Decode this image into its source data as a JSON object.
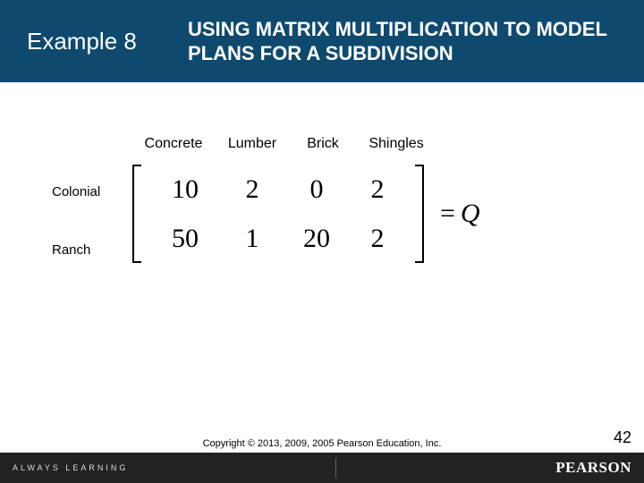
{
  "header": {
    "example_label": "Example 8",
    "title": "USING MATRIX MULTIPLICATION TO MODEL PLANS FOR A SUBDIVISION"
  },
  "columns": {
    "concrete": "Concrete",
    "lumber": "Lumber",
    "brick": "Brick",
    "shingles": "Shingles"
  },
  "rows": {
    "colonial": "Colonial",
    "ranch": "Ranch"
  },
  "matrix": {
    "r1c1": "10",
    "r1c2": "2",
    "r1c3": "0",
    "r1c4": "2",
    "r2c1": "50",
    "r2c2": "1",
    "r2c3": "20",
    "r2c4": "2"
  },
  "equation": {
    "equals": "=",
    "name": "Q"
  },
  "footer": {
    "tagline": "ALWAYS LEARNING",
    "copyright": "Copyright © 2013, 2009, 2005 Pearson Education, Inc.",
    "brand": "PEARSON",
    "page": "42"
  },
  "chart_data": {
    "type": "table",
    "title": "Matrix Q",
    "columns": [
      "Concrete",
      "Lumber",
      "Brick",
      "Shingles"
    ],
    "rows": [
      "Colonial",
      "Ranch"
    ],
    "values": [
      [
        10,
        2,
        0,
        2
      ],
      [
        50,
        1,
        20,
        2
      ]
    ]
  }
}
